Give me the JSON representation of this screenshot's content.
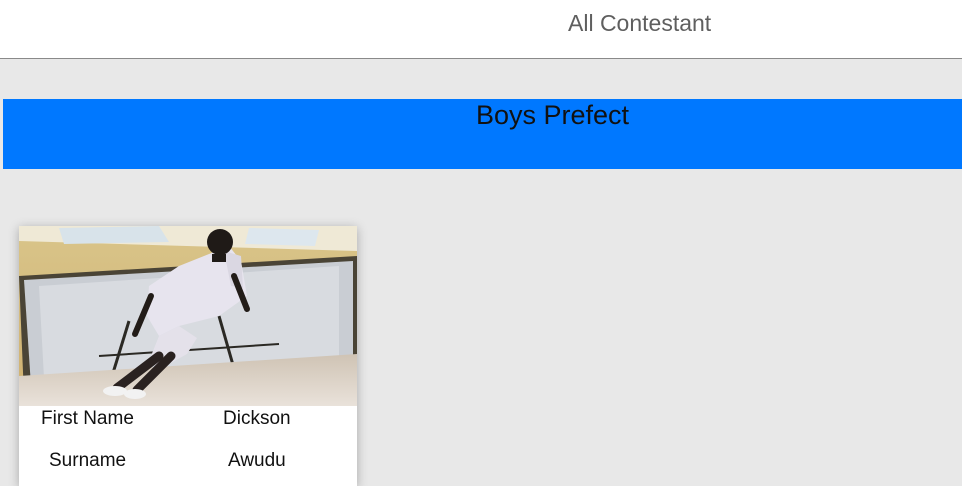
{
  "header": {
    "title": "All Contestant"
  },
  "category": {
    "title": "Boys Prefect",
    "banner_color": "#0078ff"
  },
  "contestants": [
    {
      "photo_icon": "contestant-photo",
      "fields": [
        {
          "label": "First Name",
          "value": "Dickson"
        },
        {
          "label": "Surname",
          "value": "Awudu"
        }
      ]
    }
  ]
}
